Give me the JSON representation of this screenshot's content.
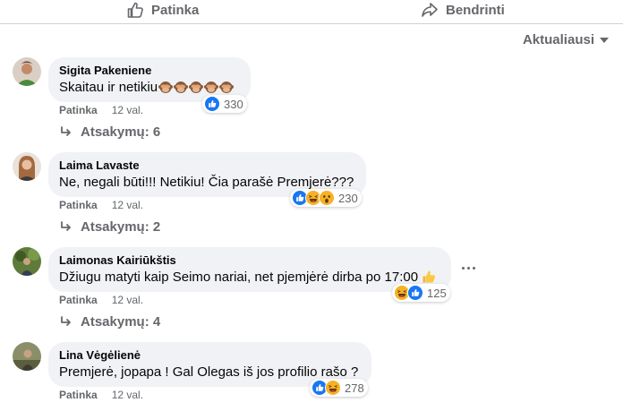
{
  "actions": {
    "like_label": "Patinka",
    "share_label": "Bendrinti"
  },
  "sort": {
    "label": "Aktualiausi"
  },
  "comments": [
    {
      "author": "Sigita Pakeniene",
      "text": "Skaitau ir netikiu",
      "text_emoji": "see-no-evil-monkey",
      "text_emoji_count": 5,
      "reactions": [
        "like"
      ],
      "reaction_count": "330",
      "like_label": "Patinka",
      "time": "12 val.",
      "replies_label": "Atsakymų: 6"
    },
    {
      "author": "Laima Lavaste",
      "text": "Ne, negali būti!!! Netikiu! Čia parašė Premjerė???",
      "reactions": [
        "like",
        "haha",
        "wow"
      ],
      "reaction_count": "230",
      "like_label": "Patinka",
      "time": "12 val.",
      "replies_label": "Atsakymų: 2"
    },
    {
      "author": "Laimonas Kairiūkštis",
      "text": "Džiugu matyti kaip Seimo nariai, net pjemjėrė dirba po 17:00",
      "text_emoji": "thumbs-up",
      "reactions": [
        "haha",
        "like"
      ],
      "reaction_count": "125",
      "like_label": "Patinka",
      "time": "12 val.",
      "replies_label": "Atsakymų: 4"
    },
    {
      "author": "Lina Vėgėlienė",
      "text": "Premjerė, jopapa ! Gal Olegas iš jos profilio rašo ?",
      "reactions": [
        "like",
        "haha"
      ],
      "reaction_count": "278",
      "like_label": "Patinka",
      "time": "12 val."
    }
  ],
  "colors": {
    "bubble": "#f0f2f5",
    "secondary_text": "#65676b",
    "like_blue": "#1877f2",
    "haha_yellow": "#f7b125"
  }
}
